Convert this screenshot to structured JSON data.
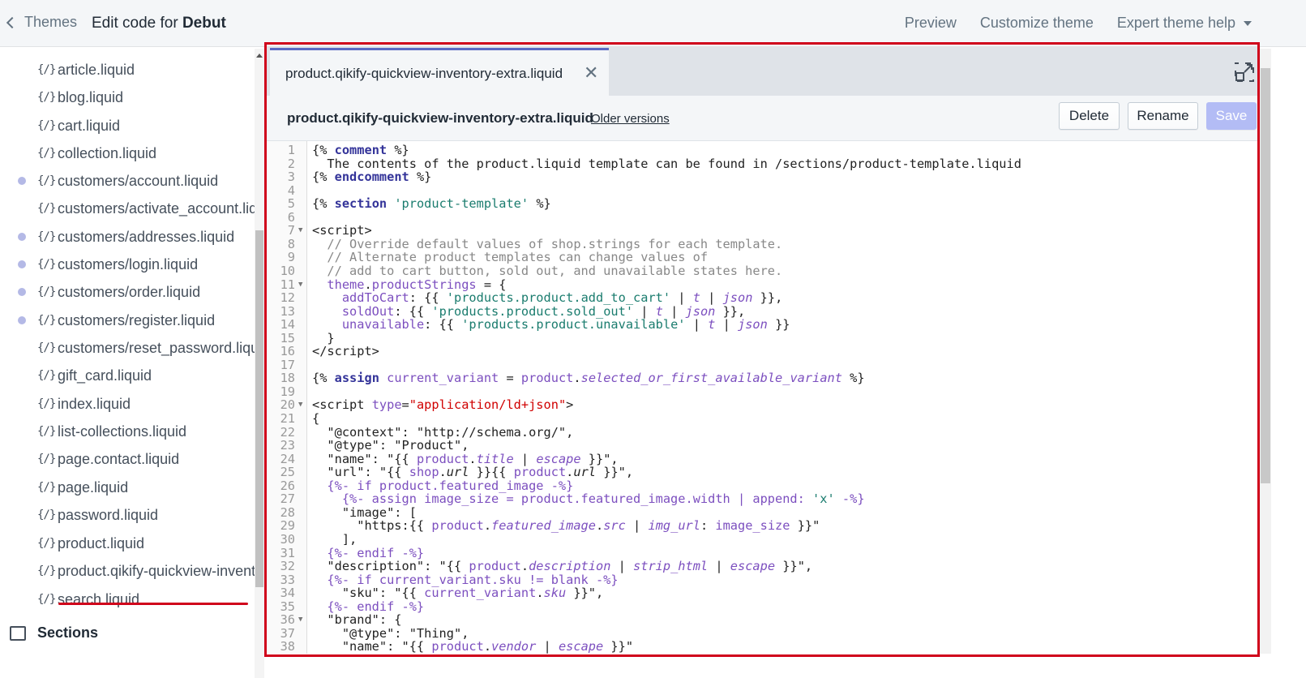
{
  "topbar": {
    "back_label": "Themes",
    "title_prefix": "Edit code for ",
    "theme_name": "Debut",
    "nav": [
      "Preview",
      "Customize theme",
      "Expert theme help"
    ]
  },
  "sidebar": {
    "files": [
      {
        "name": "article.liquid",
        "modified": false
      },
      {
        "name": "blog.liquid",
        "modified": false
      },
      {
        "name": "cart.liquid",
        "modified": false
      },
      {
        "name": "collection.liquid",
        "modified": false
      },
      {
        "name": "customers/account.liquid",
        "modified": true
      },
      {
        "name": "customers/activate_account.liquid",
        "modified": false
      },
      {
        "name": "customers/addresses.liquid",
        "modified": true
      },
      {
        "name": "customers/login.liquid",
        "modified": true
      },
      {
        "name": "customers/order.liquid",
        "modified": true
      },
      {
        "name": "customers/register.liquid",
        "modified": true
      },
      {
        "name": "customers/reset_password.liquid",
        "modified": false
      },
      {
        "name": "gift_card.liquid",
        "modified": false
      },
      {
        "name": "index.liquid",
        "modified": false
      },
      {
        "name": "list-collections.liquid",
        "modified": false
      },
      {
        "name": "page.contact.liquid",
        "modified": false
      },
      {
        "name": "page.liquid",
        "modified": false
      },
      {
        "name": "password.liquid",
        "modified": false
      },
      {
        "name": "product.liquid",
        "modified": false
      },
      {
        "name": "product.qikify-quickview-inventory-extra.liquid",
        "modified": false
      },
      {
        "name": "search.liquid",
        "modified": false
      }
    ],
    "file_icon_glyph": "{/}",
    "section_heading": "Sections"
  },
  "editor": {
    "tab_label": "product.qikify-quickview-inventory-extra.liquid",
    "file_title": "product.qikify-quickview-inventory-extra.liquid",
    "older_versions": "Older versions",
    "delete_label": "Delete",
    "rename_label": "Rename",
    "save_label": "Save",
    "accent_color": "#5c6ac4",
    "highlight_color": "#d0021b"
  }
}
